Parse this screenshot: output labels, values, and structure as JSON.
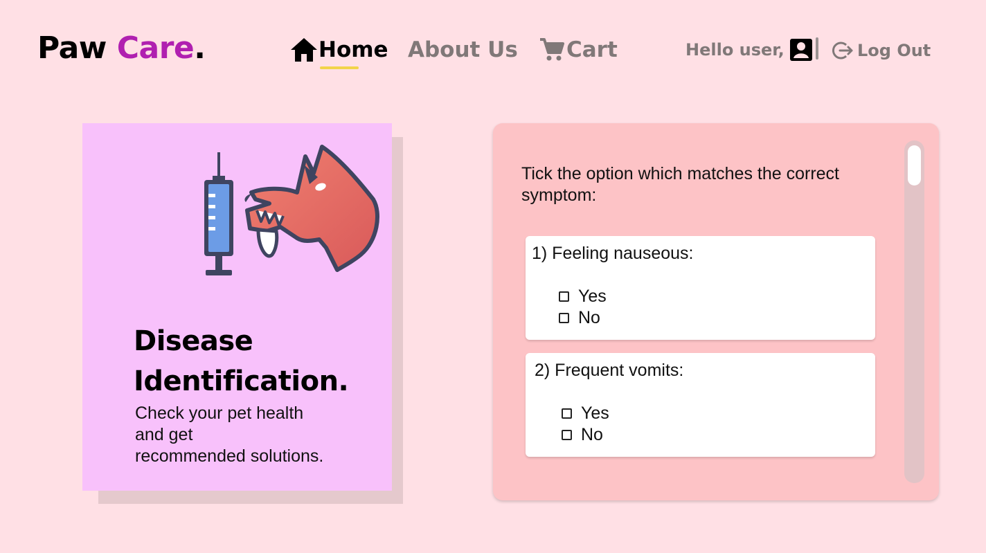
{
  "brand": {
    "part1": "Paw",
    "part2": "Care",
    "dot": "."
  },
  "nav": {
    "home": "Home",
    "about": "About Us",
    "cart": "Cart"
  },
  "user": {
    "greeting": "Hello user,",
    "logout": "Log Out"
  },
  "hero_card": {
    "title_line1": "Disease",
    "title_line2": "Identification.",
    "subtitle_lines": [
      "Check your pet health",
      "and get",
      "recommended solutions."
    ]
  },
  "quiz": {
    "prompt": "Tick the option which matches the correct symptom:",
    "questions": [
      {
        "label": "1) Feeling nauseous:",
        "options": [
          "Yes",
          "No"
        ]
      },
      {
        "label": "2) Frequent vomits:",
        "options": [
          "Yes",
          "No"
        ]
      }
    ]
  },
  "colors": {
    "background": "#ffe0e5",
    "brand_accent": "#b020b0",
    "card": "#f8c1fb",
    "quiz_panel": "#fdc3c6",
    "active_underline": "#f2d44a"
  },
  "icons": [
    "home-icon",
    "cart-icon",
    "user-icon",
    "logout-icon",
    "syringe-icon",
    "dog-icon"
  ]
}
